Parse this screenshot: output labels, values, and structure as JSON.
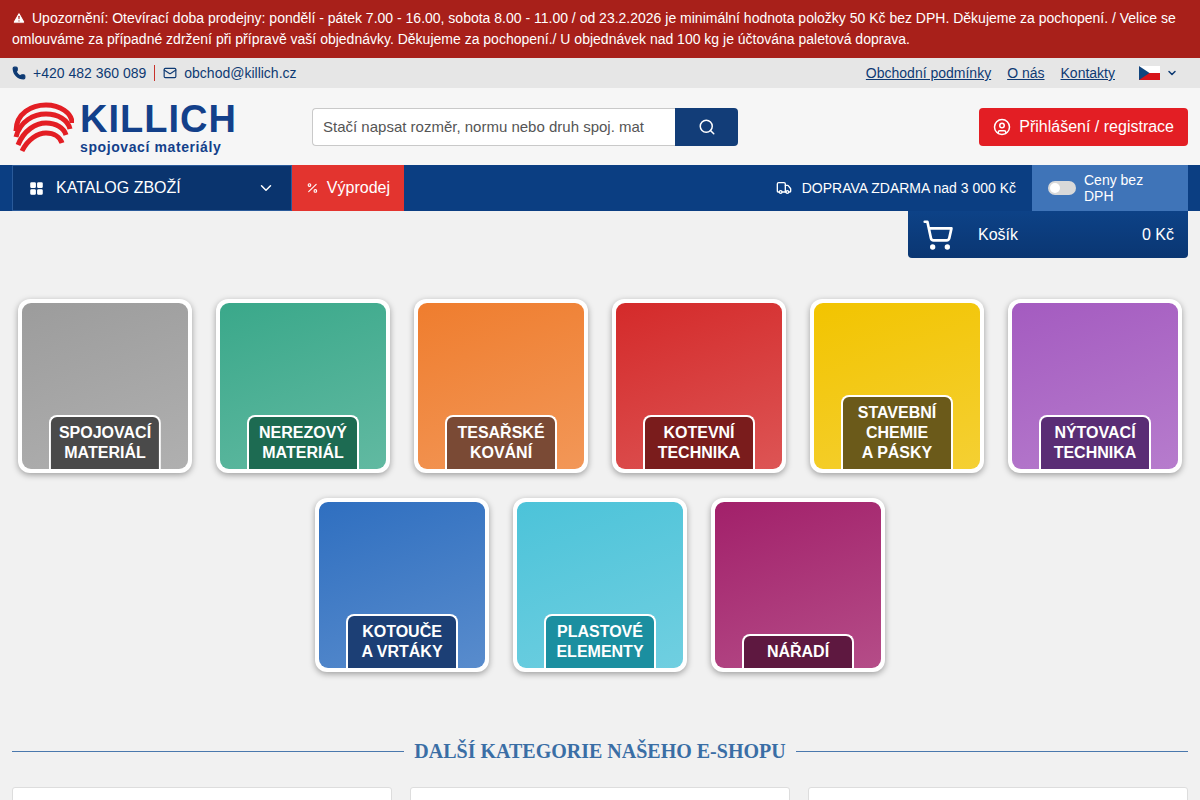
{
  "notice": {
    "text": "Upozornění: Otevírací doba prodejny: pondělí - pátek 7.00 - 16.00, sobota 8.00 - 11.00 / od 23.2.2026 je minimální hodnota položky 50 Kč bez DPH. Děkujeme za pochopení. / Velice se omlouváme za případné zdržení při přípravě vaší objednávky. Děkujeme za pochopení./ U objednávek nad 100 kg je účtována paletová doprava."
  },
  "contact": {
    "phone": "+420 482 360 089",
    "email": "obchod@killich.cz"
  },
  "top_links": [
    "Obchodní podmínky",
    "O nás",
    "Kontakty"
  ],
  "logo": {
    "name": "KILLICH",
    "tagline": "spojovací materiály"
  },
  "search": {
    "placeholder": "Stačí napsat rozměr, normu nebo druh spoj. mat"
  },
  "login_button": "Přihlášení / registrace",
  "nav": {
    "catalog": "KATALOG ZBOŽÍ",
    "sale": "Výprodej",
    "shipping": "DOPRAVA ZDARMA nad 3 000 Kč",
    "vat_toggle": {
      "label": "Ceny bez DPH",
      "on": false
    }
  },
  "cart": {
    "label": "Košík",
    "total": "0 Kč"
  },
  "categories": [
    {
      "lines": [
        "SPOJOVACÍ",
        "MATERIÁL"
      ],
      "color": "#9c9c9c",
      "badge_color": "#4a4a4a"
    },
    {
      "lines": [
        "NEREZOVÝ",
        "MATERIÁL"
      ],
      "color": "#3aa88a",
      "badge_color": "#1d6b52"
    },
    {
      "lines": [
        "TESAŘSKÉ",
        "KOVÁNÍ"
      ],
      "color": "#ef7d2e",
      "badge_color": "#7a4a35"
    },
    {
      "lines": [
        "KOTEVNÍ",
        "TECHNIKA"
      ],
      "color": "#d42a2a",
      "badge_color": "#7a1c1c"
    },
    {
      "lines": [
        "STAVEBNÍ",
        "CHEMIE",
        "A PÁSKY"
      ],
      "color": "#f2c400",
      "badge_color": "#6b5a1a"
    },
    {
      "lines": [
        "NÝTOVACÍ",
        "TECHNIKA"
      ],
      "color": "#a45bc0",
      "badge_color": "#5a2d75"
    },
    {
      "lines": [
        "KOTOUČE",
        "A VRTÁKY"
      ],
      "color": "#2f6fc0",
      "badge_color": "#1c3f75"
    },
    {
      "lines": [
        "PLASTOVÉ",
        "ELEMENTY"
      ],
      "color": "#4cc3d9",
      "badge_color": "#1b8fa0"
    },
    {
      "lines": [
        "NÁŘADÍ"
      ],
      "color": "#a2206a",
      "badge_color": "#5e1840"
    }
  ],
  "more_heading": "DALŠÍ KATEGORIE NAŠEHO E-SHOPU"
}
